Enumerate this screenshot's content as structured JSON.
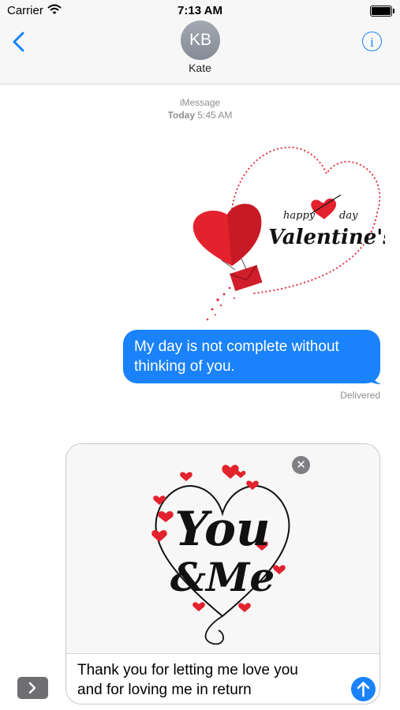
{
  "status_bar": {
    "carrier": "Carrier",
    "time": "7:13 AM"
  },
  "nav": {
    "avatar_initials": "KB",
    "contact_name": "Kate"
  },
  "thread": {
    "service": "iMessage",
    "day": "Today",
    "time": "5:45 AM",
    "sticker1_text_top": "happy",
    "sticker1_text_day": "day",
    "sticker1_text_main": "Valentine's",
    "message": "My day is not complete without thinking of you.",
    "status": "Delivered"
  },
  "compose": {
    "sticker_text_1": "You",
    "sticker_text_2": "&Me",
    "text_line1": "Thank you for letting me love you",
    "text_line2": "and for loving me in return"
  },
  "icons": {
    "back": "chevron-left-icon",
    "info": "info-icon",
    "remove": "close-icon",
    "send": "arrow-up-icon",
    "expand": "chevron-right-icon",
    "wifi": "wifi-icon",
    "battery": "battery-icon"
  },
  "colors": {
    "accent": "#1a82fb",
    "bubble_text": "#ffffff",
    "heart": "#e3222e"
  }
}
